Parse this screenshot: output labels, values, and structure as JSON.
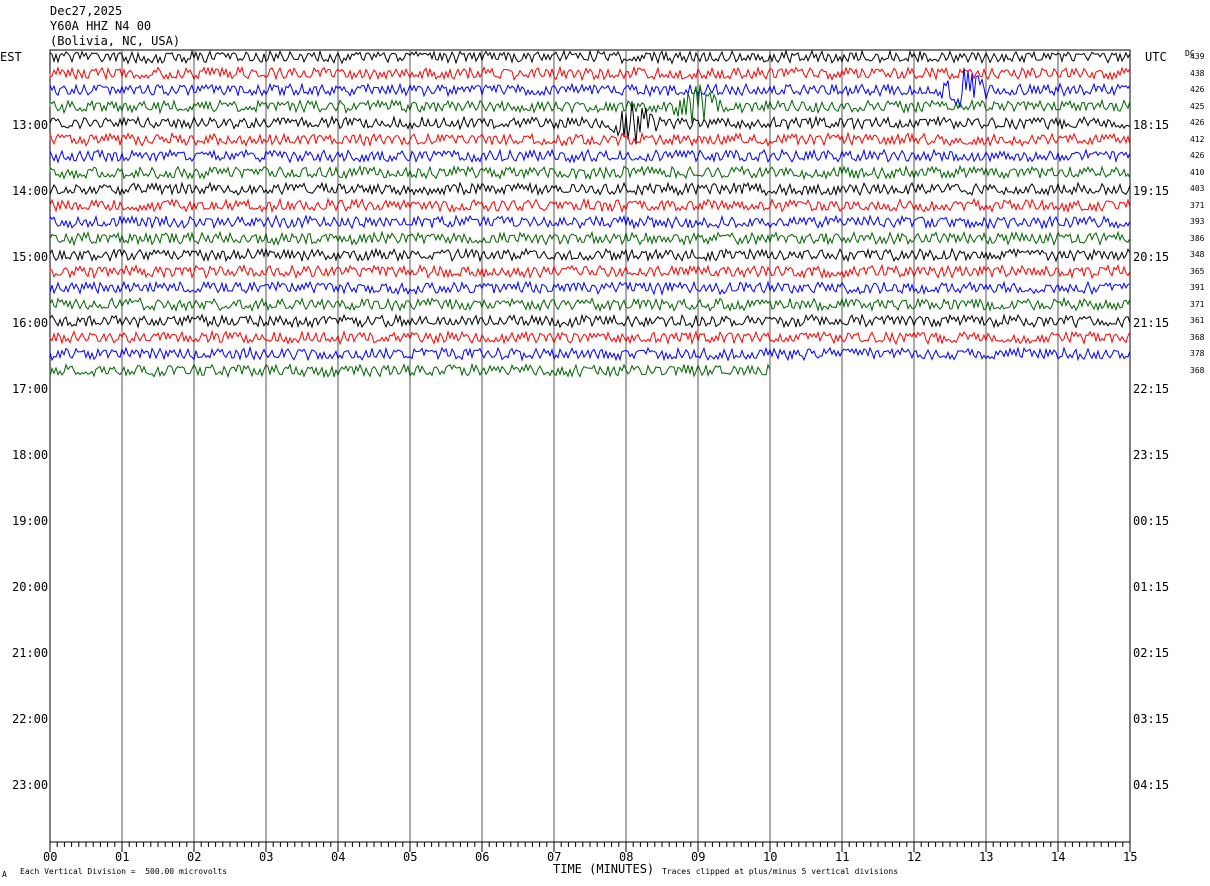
{
  "header": {
    "date": "Dec27,2025",
    "station": "Y60A HHZ N4 00",
    "location": "(Bolivia, NC, USA)"
  },
  "left_axis_title": "EST",
  "right_axis_title": "UTC",
  "dc_title": "DC",
  "chart_data": {
    "type": "line",
    "title": "",
    "xlabel": "TIME (MINUTES)",
    "xlim": [
      0,
      15
    ],
    "x_ticks": [
      "00",
      "01",
      "02",
      "03",
      "04",
      "05",
      "06",
      "07",
      "08",
      "09",
      "10",
      "11",
      "12",
      "13",
      "14",
      "15"
    ],
    "left_time_labels": [
      "13:00",
      "14:00",
      "15:00",
      "16:00",
      "17:00",
      "18:00",
      "19:00",
      "20:00",
      "21:00",
      "22:00",
      "23:00"
    ],
    "right_time_labels": [
      "18:15",
      "19:15",
      "20:15",
      "21:15",
      "22:15",
      "23:15",
      "00:15",
      "01:15",
      "02:15",
      "03:15",
      "04:15"
    ],
    "trace_colors": [
      "#000000",
      "#ff0000",
      "#0000ff",
      "#006400"
    ],
    "traces": [
      {
        "dc": "439",
        "color": "#000000",
        "minutes": 15
      },
      {
        "dc": "438",
        "color": "#ff0000",
        "minutes": 15
      },
      {
        "dc": "426",
        "color": "#0000ff",
        "minutes": 15,
        "event_at_min": 12.7
      },
      {
        "dc": "425",
        "color": "#006400",
        "minutes": 15,
        "event_at_min": 9.0
      },
      {
        "dc": "426",
        "color": "#000000",
        "minutes": 15,
        "event_at_min": 8.1
      },
      {
        "dc": "412",
        "color": "#ff0000",
        "minutes": 15
      },
      {
        "dc": "426",
        "color": "#0000ff",
        "minutes": 15
      },
      {
        "dc": "410",
        "color": "#006400",
        "minutes": 15
      },
      {
        "dc": "403",
        "color": "#000000",
        "minutes": 15
      },
      {
        "dc": "371",
        "color": "#ff0000",
        "minutes": 15
      },
      {
        "dc": "393",
        "color": "#0000ff",
        "minutes": 15
      },
      {
        "dc": "386",
        "color": "#006400",
        "minutes": 15
      },
      {
        "dc": "348",
        "color": "#000000",
        "minutes": 15
      },
      {
        "dc": "365",
        "color": "#ff0000",
        "minutes": 15
      },
      {
        "dc": "391",
        "color": "#0000ff",
        "minutes": 15
      },
      {
        "dc": "371",
        "color": "#006400",
        "minutes": 15
      },
      {
        "dc": "361",
        "color": "#000000",
        "minutes": 15
      },
      {
        "dc": "368",
        "color": "#ff0000",
        "minutes": 15
      },
      {
        "dc": "378",
        "color": "#0000ff",
        "minutes": 15
      },
      {
        "dc": "368",
        "color": "#006400",
        "minutes": 10
      }
    ],
    "grid": true
  },
  "footer": {
    "scale_note": "Each Vertical Division =  500.00 microvolts",
    "clip_note": "Traces clipped at plus/minus 5 vertical divisions",
    "corner_mark": "A"
  }
}
